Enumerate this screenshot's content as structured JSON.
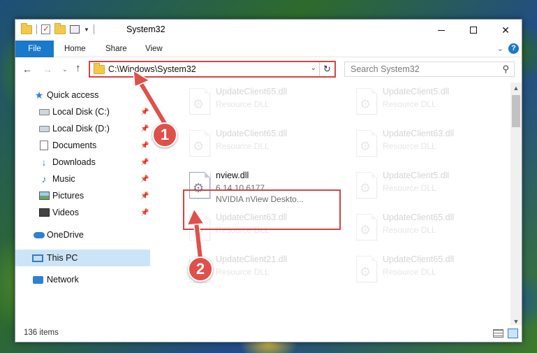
{
  "window": {
    "title": "System32",
    "controls": {
      "minimize": "minimize",
      "maximize": "maximize",
      "close": "✕"
    }
  },
  "ribbon": {
    "tabs": [
      "File",
      "Home",
      "Share",
      "View"
    ],
    "help": "?"
  },
  "nav": {
    "address": "C:\\Windows\\System32",
    "search_placeholder": "Search System32"
  },
  "sidebar": {
    "items": [
      {
        "label": "Quick access",
        "icon": "star-icon",
        "pinned": false
      },
      {
        "label": "Local Disk (C:)",
        "icon": "drive-icon",
        "pinned": true
      },
      {
        "label": "Local Disk (D:)",
        "icon": "drive-icon",
        "pinned": true
      },
      {
        "label": "Documents",
        "icon": "documents-icon",
        "pinned": true
      },
      {
        "label": "Downloads",
        "icon": "downloads-icon",
        "pinned": true
      },
      {
        "label": "Music",
        "icon": "music-icon",
        "pinned": true
      },
      {
        "label": "Pictures",
        "icon": "pictures-icon",
        "pinned": true
      },
      {
        "label": "Videos",
        "icon": "videos-icon",
        "pinned": true
      },
      {
        "label": "OneDrive",
        "icon": "onedrive-icon",
        "pinned": false
      },
      {
        "label": "This PC",
        "icon": "this-pc-icon",
        "pinned": false,
        "selected": true
      },
      {
        "label": "Network",
        "icon": "network-icon",
        "pinned": false
      }
    ]
  },
  "files": [
    {
      "name": "UpdateClient65.dll",
      "line1": "Resource DLL",
      "line2": "",
      "faded": true
    },
    {
      "name": "UpdateClient5.dll",
      "line1": "Resource DLL",
      "line2": "",
      "faded": true
    },
    {
      "name": "UpdateClient65.dll",
      "line1": "Resource DLL",
      "line2": "",
      "faded": true
    },
    {
      "name": "UpdateClient63.dll",
      "line1": "Resource DLL",
      "line2": "",
      "faded": true
    },
    {
      "name": "nview.dll",
      "line1": "6.14.10.6177",
      "line2": "NVIDIA nView Deskto...",
      "faded": false
    },
    {
      "name": "UpdateClient5.dll",
      "line1": "Resource DLL",
      "line2": "",
      "faded": true
    },
    {
      "name": "UpdateClient63.dll",
      "line1": "Resource DLL",
      "line2": "",
      "faded": true
    },
    {
      "name": "UpdateClient65.dll",
      "line1": "Resource DLL",
      "line2": "",
      "faded": true
    },
    {
      "name": "UpdateClient21.dll",
      "line1": "Resource DLL",
      "line2": "",
      "faded": true
    },
    {
      "name": "UpdateClient65.dll",
      "line1": "Resource DLL",
      "line2": "",
      "faded": true
    }
  ],
  "status": {
    "item_count": "136 items"
  },
  "annotations": {
    "step1": "1",
    "step2": "2",
    "color": "#e0504b"
  }
}
